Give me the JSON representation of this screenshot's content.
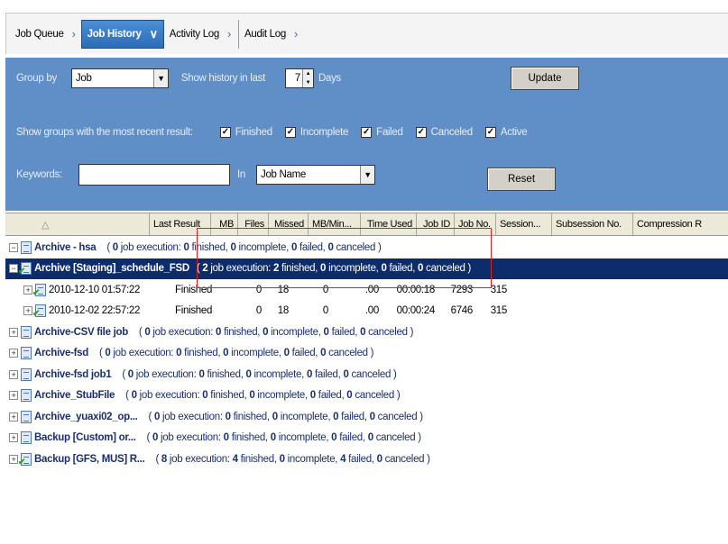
{
  "tabs": [
    {
      "label": "Job Queue",
      "sep": "›",
      "active": false
    },
    {
      "label": "Job History",
      "sep": "∨",
      "active": true
    },
    {
      "label": "Activity Log",
      "sep": "›",
      "active": false
    },
    {
      "label": "Audit Log",
      "sep": "›",
      "active": false
    }
  ],
  "filters": {
    "group_by_label": "Group by",
    "group_by_value": "Job",
    "show_history_label": "Show history in last",
    "days_value": "7",
    "days_label": "Days",
    "update_button": "Update",
    "recent_result_label": "Show groups with the most recent result:",
    "checkboxes": [
      {
        "label": "Finished",
        "checked": true
      },
      {
        "label": "Incomplete",
        "checked": true
      },
      {
        "label": "Failed",
        "checked": true
      },
      {
        "label": "Canceled",
        "checked": true
      },
      {
        "label": "Active",
        "checked": true
      }
    ],
    "keywords_label": "Keywords:",
    "keywords_value": "",
    "in_label": "In",
    "in_value": "Job Name",
    "reset_button": "Reset"
  },
  "columns": [
    "",
    "Last Result",
    "MB",
    "Files",
    "Missed",
    "MB/Min...",
    "Time Used",
    "Job ID",
    "Job No.",
    "Session...",
    "Subsession No.",
    "Compression R"
  ],
  "rows": [
    {
      "type": "group",
      "name": "Archive - hsa",
      "icon": "doc",
      "summary": {
        "count": "0",
        "finished": "0",
        "incomplete": "0",
        "failed": "0",
        "canceled": "0"
      }
    },
    {
      "type": "group",
      "selected": true,
      "name": "Archive [Staging]_schedule_FSD",
      "icon": "doc-check",
      "summary": {
        "count": "2",
        "finished": "2",
        "incomplete": "0",
        "failed": "0",
        "canceled": "0"
      }
    },
    {
      "type": "job",
      "name": "2010-12-10 01:57:22",
      "last_result": "Finished",
      "mb": "0",
      "files": "18",
      "missed": "0",
      "mb_min": ".00",
      "time_used": "00:00:18",
      "job_id": "7293",
      "job_no": "315"
    },
    {
      "type": "job",
      "name": "2010-12-02 22:57:22",
      "last_result": "Finished",
      "mb": "0",
      "files": "18",
      "missed": "0",
      "mb_min": ".00",
      "time_used": "00:00:24",
      "job_id": "6746",
      "job_no": "315"
    },
    {
      "type": "group",
      "name": "Archive-CSV file job",
      "icon": "doc",
      "summary": {
        "count": "0",
        "finished": "0",
        "incomplete": "0",
        "failed": "0",
        "canceled": "0"
      }
    },
    {
      "type": "group",
      "name": "Archive-fsd",
      "icon": "doc",
      "summary": {
        "count": "0",
        "finished": "0",
        "incomplete": "0",
        "failed": "0",
        "canceled": "0"
      }
    },
    {
      "type": "group",
      "name": "Archive-fsd job1",
      "icon": "doc",
      "summary": {
        "count": "0",
        "finished": "0",
        "incomplete": "0",
        "failed": "0",
        "canceled": "0"
      }
    },
    {
      "type": "group",
      "name": "Archive_StubFile",
      "icon": "doc",
      "summary": {
        "count": "0",
        "finished": "0",
        "incomplete": "0",
        "failed": "0",
        "canceled": "0"
      }
    },
    {
      "type": "group",
      "name": "Archive_yuaxi02_op...",
      "icon": "doc",
      "summary": {
        "count": "0",
        "finished": "0",
        "incomplete": "0",
        "failed": "0",
        "canceled": "0"
      }
    },
    {
      "type": "group",
      "name": "Backup [Custom] or...",
      "icon": "doc",
      "summary": {
        "count": "0",
        "finished": "0",
        "incomplete": "0",
        "failed": "0",
        "canceled": "0"
      }
    },
    {
      "type": "group",
      "name": "Backup [GFS, MUS] R...",
      "icon": "doc-check",
      "summary": {
        "count": "8",
        "finished": "4",
        "incomplete": "0",
        "failed": "4",
        "canceled": "0"
      }
    }
  ],
  "summary_words": {
    "execution": "job execution:",
    "finished": "finished,",
    "incomplete": "incomplete,",
    "failed": "failed,",
    "canceled": "canceled"
  },
  "colors": {
    "panel": "#5f8fc6",
    "selected_row": "#0d2c6b",
    "annotation": "#dd2222"
  }
}
